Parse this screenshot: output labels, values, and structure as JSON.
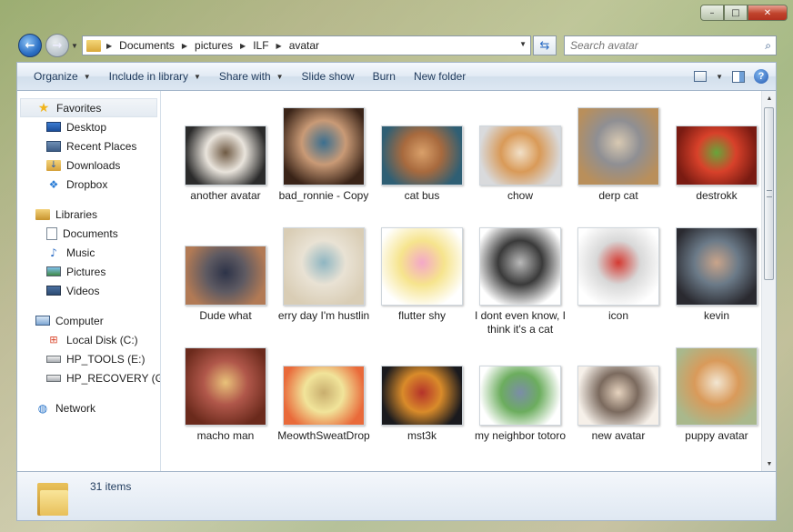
{
  "window": {
    "minimize_glyph": "–",
    "maximize_glyph": "□",
    "close_glyph": "✕"
  },
  "address": {
    "crumbs": [
      "Documents",
      "pictures",
      "ILF",
      "avatar"
    ]
  },
  "search": {
    "placeholder": "Search avatar"
  },
  "toolbar": {
    "organize": "Organize",
    "include_in_library": "Include in library",
    "share_with": "Share with",
    "slide_show": "Slide show",
    "burn": "Burn",
    "new_folder": "New folder",
    "help": "?"
  },
  "sidebar": {
    "favorites": {
      "label": "Favorites",
      "items": [
        "Desktop",
        "Recent Places",
        "Downloads",
        "Dropbox"
      ]
    },
    "libraries": {
      "label": "Libraries",
      "items": [
        "Documents",
        "Music",
        "Pictures",
        "Videos"
      ]
    },
    "computer": {
      "label": "Computer",
      "items": [
        "Local Disk (C:)",
        "HP_TOOLS (E:)",
        "HP_RECOVERY (G:)"
      ]
    },
    "network": {
      "label": "Network"
    }
  },
  "files": [
    {
      "name": "another avatar",
      "colors": [
        "#2b2b2b",
        "#e9e4dc",
        "#6f5a44"
      ]
    },
    {
      "name": "bad_ronnie - Copy",
      "colors": [
        "#3a2418",
        "#c99a76",
        "#3b6f8f"
      ]
    },
    {
      "name": "cat bus",
      "colors": [
        "#2f5f74",
        "#a86a3e",
        "#d9a06a"
      ]
    },
    {
      "name": "chow",
      "colors": [
        "#d9dadc",
        "#d99a58",
        "#f1e0c8"
      ]
    },
    {
      "name": "derp cat",
      "colors": [
        "#b98f5b",
        "#8f8f93",
        "#d8c9b2"
      ]
    },
    {
      "name": "destrokk",
      "colors": [
        "#7a1b12",
        "#d8412a",
        "#67a53b"
      ]
    },
    {
      "name": "Dude what",
      "colors": [
        "#b27a55",
        "#5e5a62",
        "#2d3348"
      ]
    },
    {
      "name": "erry day I'm hustlin",
      "colors": [
        "#d9cdb5",
        "#e9e2d4",
        "#8fb6c2"
      ]
    },
    {
      "name": "flutter shy",
      "colors": [
        "#ffffff",
        "#f6e48d",
        "#f4a8c8"
      ]
    },
    {
      "name": "I dont even know, I think it's a cat",
      "colors": [
        "#ffffff",
        "#3a3a3a",
        "#b9b9b9"
      ]
    },
    {
      "name": "icon",
      "colors": [
        "#ffffff",
        "#d8d8d8",
        "#d43a32"
      ]
    },
    {
      "name": "kevin",
      "colors": [
        "#2a2a30",
        "#6b7a88",
        "#c9a48a"
      ]
    },
    {
      "name": "macho man",
      "colors": [
        "#6b2a1c",
        "#b0574a",
        "#e9c27a"
      ]
    },
    {
      "name": "MeowthSweatDrop",
      "colors": [
        "#e96a3a",
        "#f1e49a",
        "#c9ae6e"
      ]
    },
    {
      "name": "mst3k",
      "colors": [
        "#1a1a1e",
        "#d98b2a",
        "#b5332a"
      ]
    },
    {
      "name": "my neighbor totoro",
      "colors": [
        "#ffffff",
        "#6cad5e",
        "#7b8da8"
      ]
    },
    {
      "name": "new avatar",
      "colors": [
        "#f6f0e9",
        "#7b6a5e",
        "#e6d3bf"
      ]
    },
    {
      "name": "puppy avatar",
      "colors": [
        "#a9b88c",
        "#d99a5a",
        "#f2e6d2"
      ]
    }
  ],
  "details": {
    "item_count": "31 items"
  }
}
